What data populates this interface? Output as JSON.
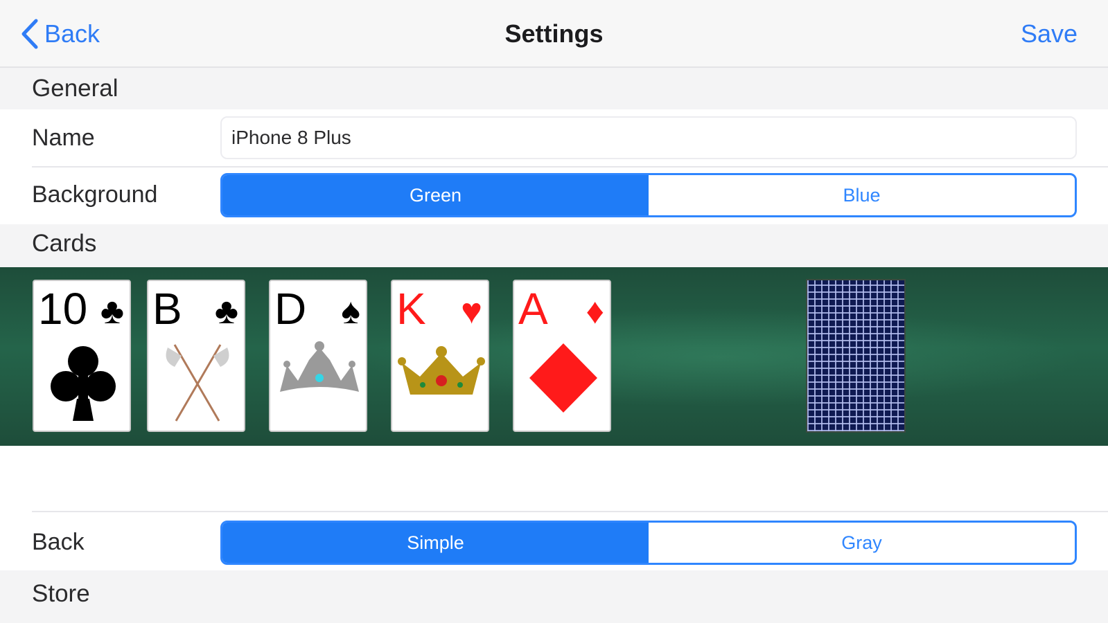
{
  "nav": {
    "back_label": "Back",
    "title": "Settings",
    "save_label": "Save"
  },
  "general": {
    "header": "General",
    "name_label": "Name",
    "name_value": "iPhone 8 Plus",
    "background_label": "Background",
    "background_options": [
      "Green",
      "Blue"
    ],
    "background_selected": "Green"
  },
  "cards": {
    "header": "Cards",
    "preview": [
      {
        "rank": "10",
        "suit": "♣",
        "color": "black",
        "art": "club-icon"
      },
      {
        "rank": "B",
        "suit": "♣",
        "color": "black",
        "art": "crossed-axes-icon"
      },
      {
        "rank": "D",
        "suit": "♠",
        "color": "black",
        "art": "tiara-icon"
      },
      {
        "rank": "K",
        "suit": "♥",
        "color": "red",
        "art": "crown-icon"
      },
      {
        "rank": "A",
        "suit": "♦",
        "color": "red",
        "art": "diamond-icon"
      }
    ],
    "back_label": "Back",
    "back_options": [
      "Simple",
      "Gray"
    ],
    "back_selected": "Simple"
  },
  "store": {
    "header": "Store"
  },
  "colors": {
    "accent": "#2f86ff",
    "felt": "#1e4d3a",
    "red_suit": "#ff1a1a"
  }
}
